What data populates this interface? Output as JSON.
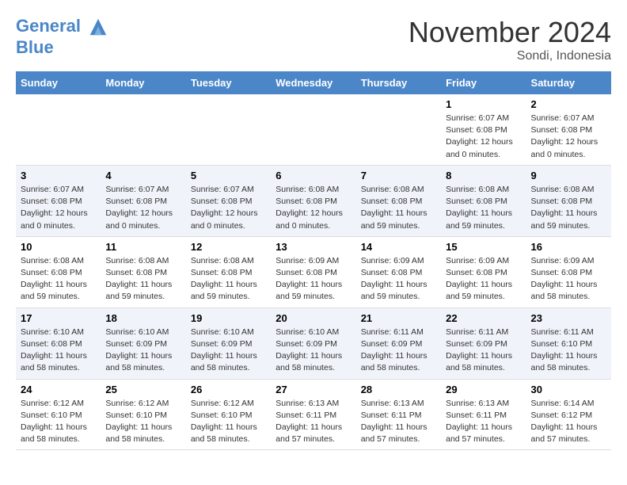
{
  "header": {
    "logo_line1": "General",
    "logo_line2": "Blue",
    "month": "November 2024",
    "location": "Sondi, Indonesia"
  },
  "weekdays": [
    "Sunday",
    "Monday",
    "Tuesday",
    "Wednesday",
    "Thursday",
    "Friday",
    "Saturday"
  ],
  "weeks": [
    [
      {
        "day": "",
        "info": ""
      },
      {
        "day": "",
        "info": ""
      },
      {
        "day": "",
        "info": ""
      },
      {
        "day": "",
        "info": ""
      },
      {
        "day": "",
        "info": ""
      },
      {
        "day": "1",
        "info": "Sunrise: 6:07 AM\nSunset: 6:08 PM\nDaylight: 12 hours and 0 minutes."
      },
      {
        "day": "2",
        "info": "Sunrise: 6:07 AM\nSunset: 6:08 PM\nDaylight: 12 hours and 0 minutes."
      }
    ],
    [
      {
        "day": "3",
        "info": "Sunrise: 6:07 AM\nSunset: 6:08 PM\nDaylight: 12 hours and 0 minutes."
      },
      {
        "day": "4",
        "info": "Sunrise: 6:07 AM\nSunset: 6:08 PM\nDaylight: 12 hours and 0 minutes."
      },
      {
        "day": "5",
        "info": "Sunrise: 6:07 AM\nSunset: 6:08 PM\nDaylight: 12 hours and 0 minutes."
      },
      {
        "day": "6",
        "info": "Sunrise: 6:08 AM\nSunset: 6:08 PM\nDaylight: 12 hours and 0 minutes."
      },
      {
        "day": "7",
        "info": "Sunrise: 6:08 AM\nSunset: 6:08 PM\nDaylight: 11 hours and 59 minutes."
      },
      {
        "day": "8",
        "info": "Sunrise: 6:08 AM\nSunset: 6:08 PM\nDaylight: 11 hours and 59 minutes."
      },
      {
        "day": "9",
        "info": "Sunrise: 6:08 AM\nSunset: 6:08 PM\nDaylight: 11 hours and 59 minutes."
      }
    ],
    [
      {
        "day": "10",
        "info": "Sunrise: 6:08 AM\nSunset: 6:08 PM\nDaylight: 11 hours and 59 minutes."
      },
      {
        "day": "11",
        "info": "Sunrise: 6:08 AM\nSunset: 6:08 PM\nDaylight: 11 hours and 59 minutes."
      },
      {
        "day": "12",
        "info": "Sunrise: 6:08 AM\nSunset: 6:08 PM\nDaylight: 11 hours and 59 minutes."
      },
      {
        "day": "13",
        "info": "Sunrise: 6:09 AM\nSunset: 6:08 PM\nDaylight: 11 hours and 59 minutes."
      },
      {
        "day": "14",
        "info": "Sunrise: 6:09 AM\nSunset: 6:08 PM\nDaylight: 11 hours and 59 minutes."
      },
      {
        "day": "15",
        "info": "Sunrise: 6:09 AM\nSunset: 6:08 PM\nDaylight: 11 hours and 59 minutes."
      },
      {
        "day": "16",
        "info": "Sunrise: 6:09 AM\nSunset: 6:08 PM\nDaylight: 11 hours and 58 minutes."
      }
    ],
    [
      {
        "day": "17",
        "info": "Sunrise: 6:10 AM\nSunset: 6:08 PM\nDaylight: 11 hours and 58 minutes."
      },
      {
        "day": "18",
        "info": "Sunrise: 6:10 AM\nSunset: 6:09 PM\nDaylight: 11 hours and 58 minutes."
      },
      {
        "day": "19",
        "info": "Sunrise: 6:10 AM\nSunset: 6:09 PM\nDaylight: 11 hours and 58 minutes."
      },
      {
        "day": "20",
        "info": "Sunrise: 6:10 AM\nSunset: 6:09 PM\nDaylight: 11 hours and 58 minutes."
      },
      {
        "day": "21",
        "info": "Sunrise: 6:11 AM\nSunset: 6:09 PM\nDaylight: 11 hours and 58 minutes."
      },
      {
        "day": "22",
        "info": "Sunrise: 6:11 AM\nSunset: 6:09 PM\nDaylight: 11 hours and 58 minutes."
      },
      {
        "day": "23",
        "info": "Sunrise: 6:11 AM\nSunset: 6:10 PM\nDaylight: 11 hours and 58 minutes."
      }
    ],
    [
      {
        "day": "24",
        "info": "Sunrise: 6:12 AM\nSunset: 6:10 PM\nDaylight: 11 hours and 58 minutes."
      },
      {
        "day": "25",
        "info": "Sunrise: 6:12 AM\nSunset: 6:10 PM\nDaylight: 11 hours and 58 minutes."
      },
      {
        "day": "26",
        "info": "Sunrise: 6:12 AM\nSunset: 6:10 PM\nDaylight: 11 hours and 58 minutes."
      },
      {
        "day": "27",
        "info": "Sunrise: 6:13 AM\nSunset: 6:11 PM\nDaylight: 11 hours and 57 minutes."
      },
      {
        "day": "28",
        "info": "Sunrise: 6:13 AM\nSunset: 6:11 PM\nDaylight: 11 hours and 57 minutes."
      },
      {
        "day": "29",
        "info": "Sunrise: 6:13 AM\nSunset: 6:11 PM\nDaylight: 11 hours and 57 minutes."
      },
      {
        "day": "30",
        "info": "Sunrise: 6:14 AM\nSunset: 6:12 PM\nDaylight: 11 hours and 57 minutes."
      }
    ]
  ]
}
